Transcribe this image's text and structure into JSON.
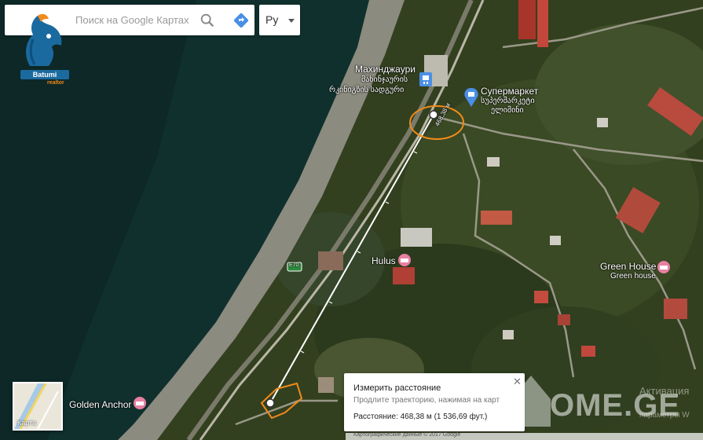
{
  "search": {
    "placeholder": "Поиск на Google Картах"
  },
  "language": {
    "label": "Ру"
  },
  "logo": {
    "name": "Batumi",
    "sub": "realtor"
  },
  "map_labels": {
    "station_ru": "Махинджаури",
    "station_ka1": "მახინჯაურის",
    "station_ka2": "რკინიგზის სადგური",
    "supermarket_ru": "Супермаркет",
    "supermarket_ka1": "სუპერმარკეტი",
    "supermarket_ka2": "ელიმინი",
    "hulus": "Hulus",
    "green_house": "Green House",
    "green_house_sub": "Green house",
    "golden_anchor": "Golden Anchor",
    "road_badge": "E70",
    "distance_along_line": "468,38 м"
  },
  "minimap": {
    "label": "Карта"
  },
  "measure_panel": {
    "title": "Измерить расстояние",
    "hint": "Продлите траекторию, нажимая на карт",
    "distance": "Расстояние: 468,38 м (1 536,69 фут.)"
  },
  "watermark": {
    "text": "OME.GE",
    "activate_line1": "Активация",
    "activate_line2": "параметры W"
  },
  "footer": {
    "text": "Картографические данные © 2017 Google"
  },
  "colors": {
    "sea": "#0e2c2c",
    "beach": "#8a8a7d",
    "vegetation": "#2d3d1e",
    "highlight": "#f08a1a",
    "poi_blue": "#4a8fe6"
  }
}
